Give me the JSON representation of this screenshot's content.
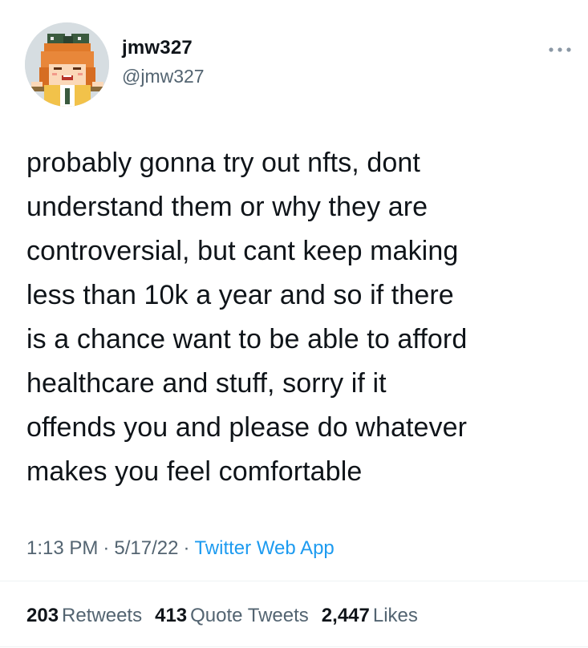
{
  "user": {
    "display_name": "jmw327",
    "handle": "@jmw327",
    "avatar_icon": "pixel-art-girl-avatar"
  },
  "tweet": {
    "lines": [
      "probably gonna try out nfts, dont",
      "understand them or why they are",
      "controversial, but cant keep making",
      "less than 10k a year and so if there",
      "is a chance want to be able to afford",
      "healthcare and stuff, sorry if it",
      "offends you and please do whatever",
      "makes you feel comfortable"
    ],
    "time": "1:13 PM",
    "date": "5/17/22",
    "separator": "·",
    "source": "Twitter Web App"
  },
  "stats": {
    "retweets_count": "203",
    "retweets_label": "Retweets",
    "quotes_count": "413",
    "quotes_label": "Quote Tweets",
    "likes_count": "2,447",
    "likes_label": "Likes"
  },
  "colors": {
    "text": "#0f1419",
    "secondary": "#536471",
    "link": "#1d9bf0",
    "divider": "#eff3f4"
  }
}
